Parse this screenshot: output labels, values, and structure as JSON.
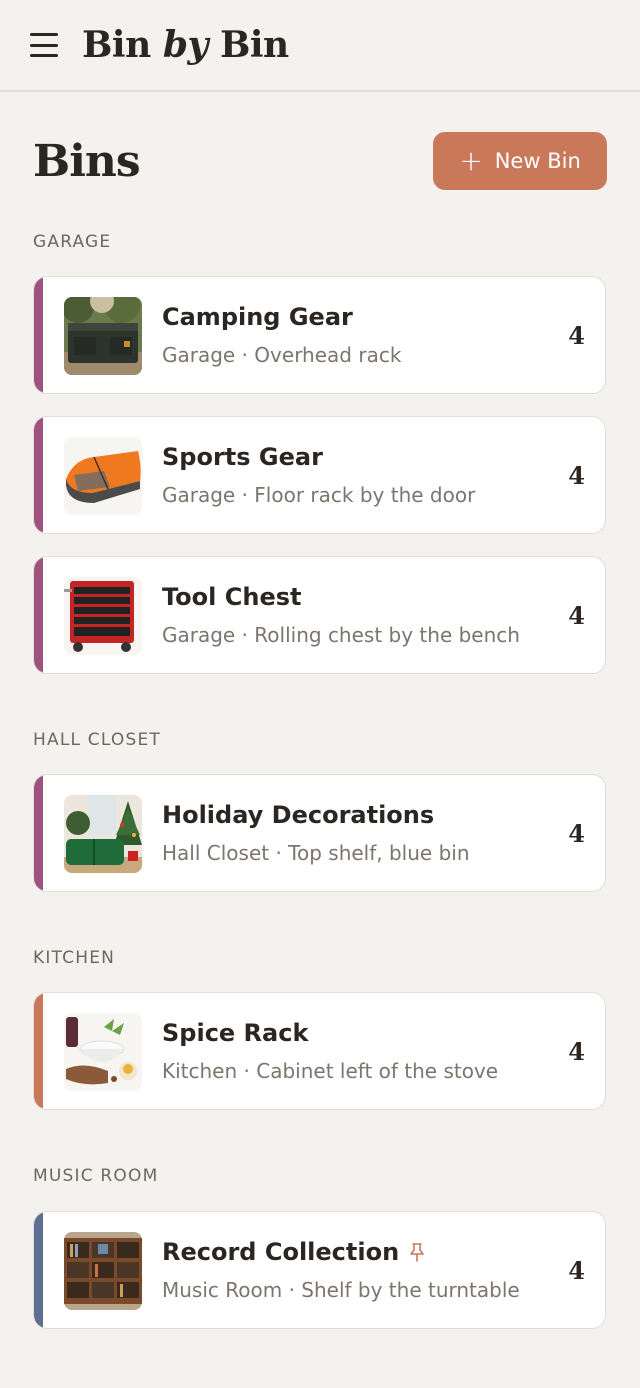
{
  "app": {
    "title_before": "Bin ",
    "title_italic": "by",
    "title_after": " Bin"
  },
  "page": {
    "title": "Bins",
    "new_bin_label": "New Bin"
  },
  "colors": {
    "accent_orange": "#c9785a",
    "stripe_purple": "#a0527e",
    "stripe_orange": "#c9785a",
    "stripe_blue": "#5e6f93"
  },
  "sections": [
    {
      "label": "GARAGE",
      "bins": [
        {
          "name": "Camping Gear",
          "location": "Garage · Overhead rack",
          "count": "4",
          "icon": "camping-gear-thumbnail"
        },
        {
          "name": "Sports Gear",
          "location": "Garage · Floor rack by the door",
          "count": "4",
          "icon": "sports-gear-thumbnail"
        },
        {
          "name": "Tool Chest",
          "location": "Garage · Rolling chest by the bench",
          "count": "4",
          "icon": "tool-chest-thumbnail"
        }
      ]
    },
    {
      "label": "HALL CLOSET",
      "bins": [
        {
          "name": "Holiday Decorations",
          "location": "Hall Closet · Top shelf, blue bin",
          "count": "4",
          "icon": "holiday-decorations-thumbnail"
        }
      ]
    },
    {
      "label": "KITCHEN",
      "bins": [
        {
          "name": "Spice Rack",
          "location": "Kitchen · Cabinet left of the stove",
          "count": "4",
          "icon": "spice-rack-thumbnail"
        }
      ]
    },
    {
      "label": "MUSIC ROOM",
      "bins": [
        {
          "name": "Record Collection",
          "location": "Music Room · Shelf by the turntable",
          "count": "4",
          "icon": "record-collection-thumbnail",
          "pinned": true
        }
      ]
    }
  ]
}
